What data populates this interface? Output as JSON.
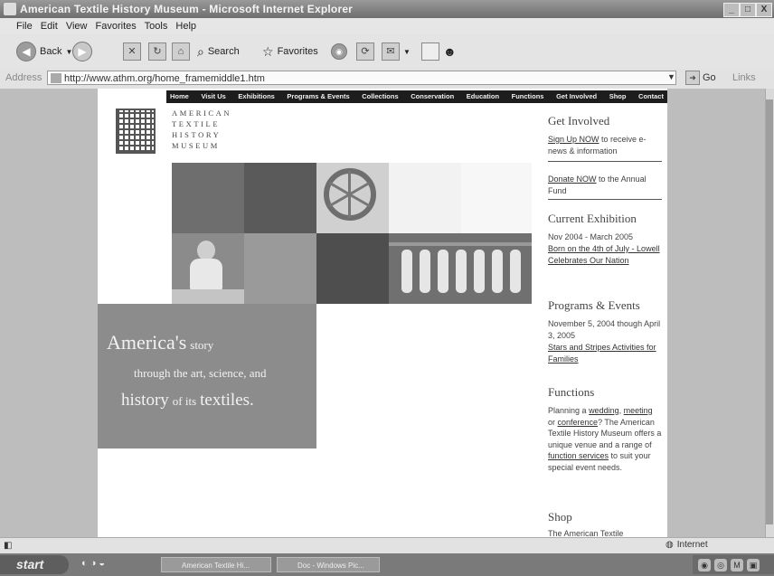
{
  "window": {
    "title": "American Textile History Museum - Microsoft Internet Explorer",
    "controls": [
      "_",
      "□",
      "X"
    ]
  },
  "menubar": {
    "items": [
      "File",
      "Edit",
      "View",
      "Favorites",
      "Tools",
      "Help"
    ]
  },
  "toolbar": {
    "back": "Back",
    "search": "Search",
    "favorites": "Favorites"
  },
  "addressbar": {
    "label": "Address",
    "url": "http://www.athm.org/home_framemiddle1.htm",
    "go": "Go",
    "links": "Links"
  },
  "site": {
    "nav": [
      "Home",
      "Visit Us",
      "Exhibitions",
      "Programs & Events",
      "Collections",
      "Conservation",
      "Education",
      "Functions",
      "Get Involved",
      "Shop",
      "Contact"
    ],
    "logo_lines": [
      "AMERICAN",
      "TEXTILE",
      "HISTORY",
      "MUSEUM"
    ],
    "tagline": {
      "w1": "America's",
      "w2": "story",
      "l2": "through the art, science, and",
      "w3": "history",
      "w4": "of its",
      "w5": "textiles."
    },
    "sidebar": {
      "get_involved": {
        "heading": "Get Involved",
        "signup_link": "Sign Up NOW",
        "signup_text": "to receive e-news & information",
        "donate_link": "Donate NOW",
        "donate_text": "to the Annual Fund"
      },
      "current_exhibition": {
        "heading": "Current Exhibition",
        "dates": "Nov 2004 - March 2005",
        "link": "Born on the 4th of July - Lowell Celebrates Our Nation"
      },
      "programs": {
        "heading": "Programs & Events",
        "dates": "November 5, 2004 though April 3, 2005",
        "link": "Stars and Stripes Activities for Families"
      },
      "functions": {
        "heading": "Functions",
        "t1": "Planning a",
        "l1": "wedding",
        "t2": ",",
        "l2": "meeting",
        "t3": "or",
        "l3": "conference",
        "t4": "? The American Textile History Museum offers a unique venue and a range of",
        "l4": "function services",
        "t5": "to suit your special event needs."
      },
      "shop": {
        "heading": "Shop",
        "text": "The American Textile"
      }
    }
  },
  "statusbar": {
    "zone": "Internet"
  },
  "taskbar": {
    "start": "start",
    "tasks": [
      "American Textile Hi...",
      "Doc - Windows Pic..."
    ]
  }
}
